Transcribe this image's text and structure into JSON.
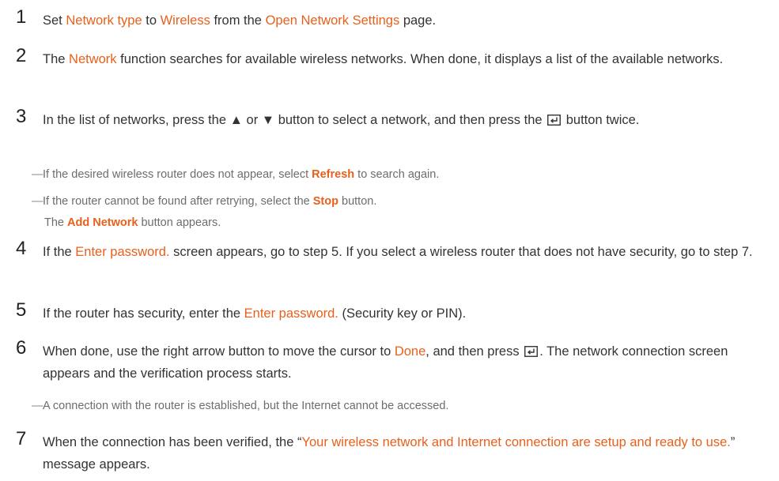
{
  "steps": [
    {
      "num": "1",
      "parts": [
        "Set ",
        "Network type",
        " to ",
        "Wireless",
        " from the ",
        "Open Network Settings",
        " page."
      ]
    },
    {
      "num": "2",
      "parts": [
        "The ",
        "Network",
        " function searches for available wireless networks. When done, it displays a list of the available networks."
      ]
    },
    {
      "num": "3",
      "parts": [
        "In the list of networks, press the ▲ or ▼ button to select a network, and then press the ",
        " button twice."
      ]
    },
    {
      "num": "4",
      "parts": [
        "If the ",
        "Enter password.",
        " screen appears, go to step 5. If you select a wireless router that does not have security, go to step 7."
      ]
    },
    {
      "num": "5",
      "parts": [
        "If the router has security, enter the ",
        "Enter password.",
        " (Security key or PIN)."
      ]
    },
    {
      "num": "6",
      "parts": [
        "When done, use the right arrow button to move the cursor to ",
        "Done",
        ", and then press ",
        ". The network connection screen appears and the verification process starts."
      ]
    },
    {
      "num": "7",
      "parts": [
        "When the connection has been verified, the “",
        "Your wireless network and Internet connection are setup and ready to use.",
        "” message appears."
      ]
    }
  ],
  "notes": {
    "refresh": [
      "If the desired wireless router does not appear, select ",
      "Refresh",
      " to search again."
    ],
    "stop": [
      "If the router cannot be found after retrying, select the ",
      "Stop",
      " button."
    ],
    "add_network": [
      "The ",
      "Add Network",
      " button appears."
    ],
    "no_internet": "A connection with the router is established, but the Internet cannot be accessed."
  },
  "note_dash": "—",
  "icons": {
    "enter": "enter-key-icon"
  },
  "colors": {
    "accent": "#e8601c",
    "text": "#333333",
    "note": "#6d6d6d"
  }
}
